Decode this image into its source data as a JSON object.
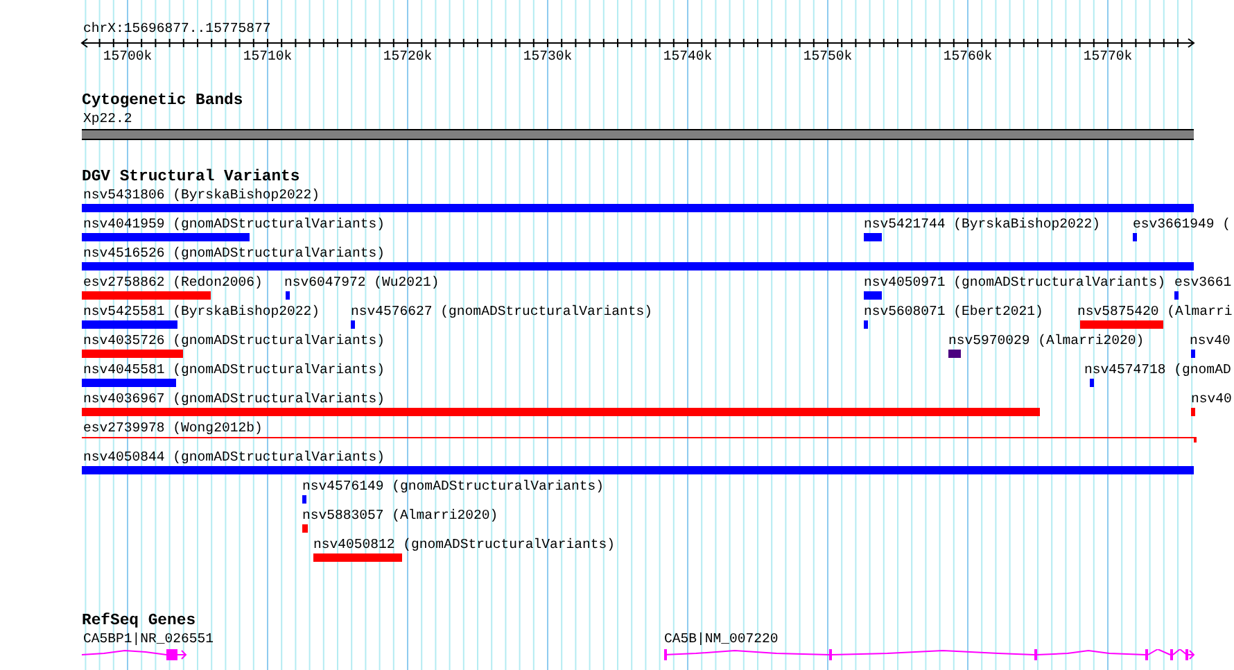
{
  "ruler": {
    "location": "chrX:15696877..15775877",
    "ticks": [
      "15700k",
      "15710k",
      "15720k",
      "15730k",
      "15740k",
      "15750k",
      "15760k",
      "15770k"
    ]
  },
  "cytobands": {
    "title": "Cytogenetic Bands",
    "bands": [
      {
        "label": "Xp22.2"
      }
    ]
  },
  "variants": {
    "title": "DGV Structural Variants",
    "rows": [
      {
        "features": [
          {
            "label": "nsv5431806 (ByrskaBishop2022)",
            "kind": "bar",
            "color": "#0000ff"
          }
        ]
      },
      {
        "features": [
          {
            "label": "nsv4041959 (gnomADStructuralVariants)",
            "kind": "bar",
            "color": "#0000ff"
          },
          {
            "label": "nsv5421744 (ByrskaBishop2022)",
            "kind": "bar",
            "color": "#0000ff"
          },
          {
            "label": "esv3661949 (",
            "kind": "bar",
            "color": "#0000ff"
          }
        ]
      },
      {
        "features": [
          {
            "label": "nsv4516526 (gnomADStructuralVariants)",
            "kind": "bar",
            "color": "#0000ff"
          }
        ]
      },
      {
        "features": [
          {
            "label": "esv2758862 (Redon2006)",
            "kind": "bar",
            "color": "#ff0000"
          },
          {
            "label": "nsv6047972 (Wu2021)",
            "kind": "bar",
            "color": "#0000ff"
          },
          {
            "label": "nsv4050971 (gnomADStructuralVariants)",
            "kind": "bar",
            "color": "#0000ff"
          },
          {
            "label": "esv3661",
            "kind": "bar",
            "color": "#0000ff"
          }
        ]
      },
      {
        "features": [
          {
            "label": "nsv5425581 (ByrskaBishop2022)",
            "kind": "bar",
            "color": "#0000ff"
          },
          {
            "label": "nsv4576627 (gnomADStructuralVariants)",
            "kind": "bar",
            "color": "#0000ff"
          },
          {
            "label": "nsv5608071 (Ebert2021)",
            "kind": "bar",
            "color": "#0000ff"
          },
          {
            "label": "nsv5875420 (Almarri",
            "kind": "bar",
            "color": "#ff0000"
          }
        ]
      },
      {
        "features": [
          {
            "label": "nsv4035726 (gnomADStructuralVariants)",
            "kind": "bar",
            "color": "#ff0000"
          },
          {
            "label": "nsv5970029 (Almarri2020)",
            "kind": "bar",
            "color": "#4b0080"
          },
          {
            "label": "nsv40",
            "kind": "bar",
            "color": "#0000ff"
          }
        ]
      },
      {
        "features": [
          {
            "label": "nsv4045581 (gnomADStructuralVariants)",
            "kind": "bar",
            "color": "#0000ff"
          },
          {
            "label": "nsv4574718 (gnomAD",
            "kind": "bar",
            "color": "#0000ff"
          }
        ]
      },
      {
        "features": [
          {
            "label": "nsv4036967 (gnomADStructuralVariants)",
            "kind": "bar",
            "color": "#ff0000"
          },
          {
            "label": "nsv40",
            "kind": "bar",
            "color": "#ff0000"
          }
        ]
      },
      {
        "features": [
          {
            "label": "esv2739978 (Wong2012b)",
            "kind": "line",
            "color": "#ff0000"
          }
        ]
      },
      {
        "features": [
          {
            "label": "nsv4050844 (gnomADStructuralVariants)",
            "kind": "bar",
            "color": "#0000ff"
          }
        ]
      },
      {
        "features": [
          {
            "label": "nsv4576149 (gnomADStructuralVariants)",
            "kind": "bar",
            "color": "#0000ff"
          }
        ]
      },
      {
        "features": [
          {
            "label": "nsv5883057 (Almarri2020)",
            "kind": "bar",
            "color": "#ff0000"
          }
        ]
      },
      {
        "features": [
          {
            "label": "nsv4050812 (gnomADStructuralVariants)",
            "kind": "bar",
            "color": "#ff0000"
          }
        ]
      }
    ]
  },
  "genes": {
    "title": "RefSeq Genes",
    "items": [
      {
        "label": "CA5BP1|NR_026551"
      },
      {
        "label": "CA5B|NM_007220"
      }
    ]
  }
}
